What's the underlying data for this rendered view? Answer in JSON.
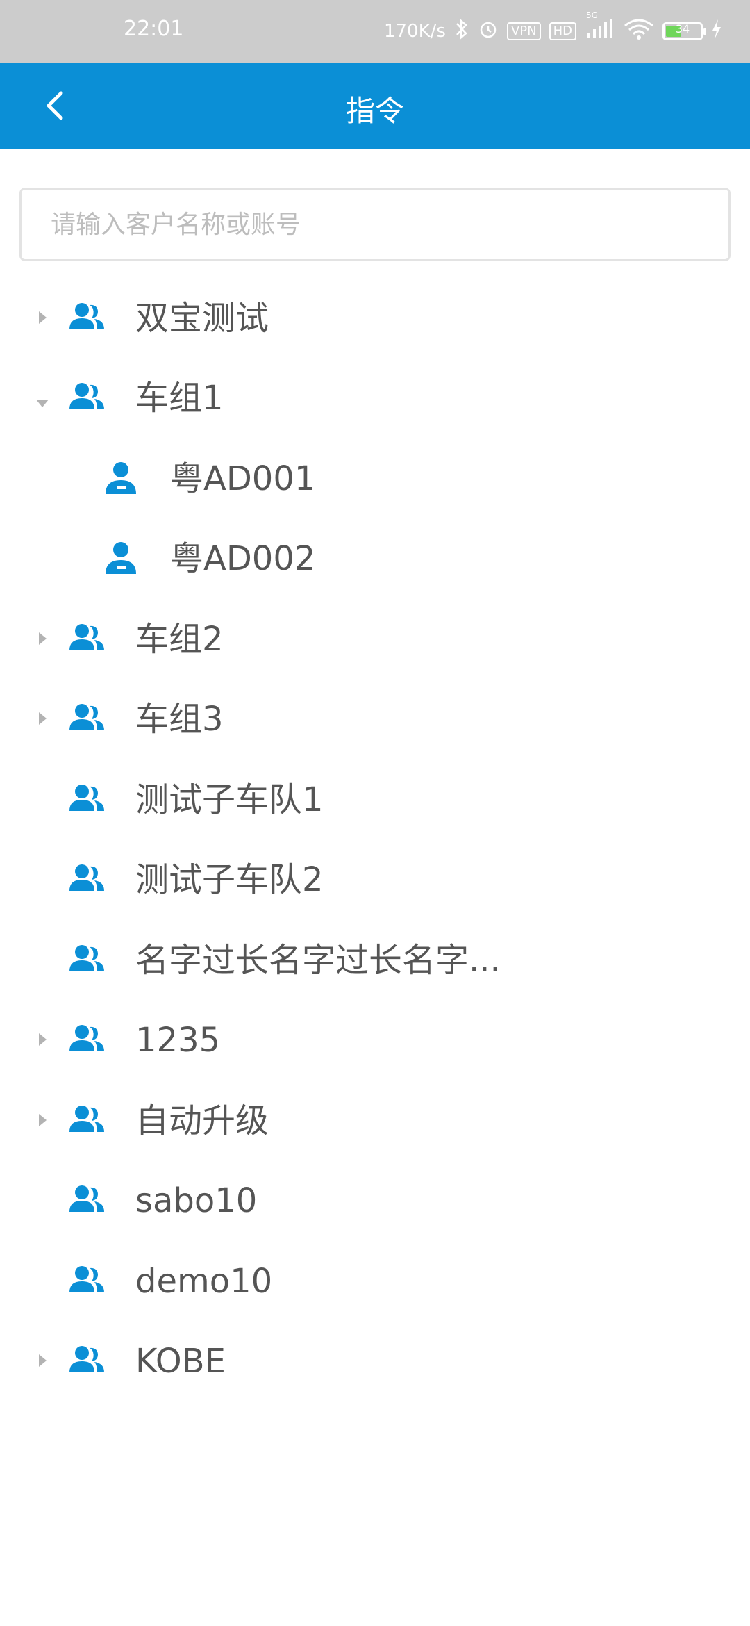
{
  "status_bar": {
    "time": "22:01",
    "network_speed": "170K/s",
    "vpn": "VPN",
    "hd": "HD",
    "signal_label": "5G",
    "battery_level": "34"
  },
  "header": {
    "title": "指令",
    "back_icon": "chevron-left-icon"
  },
  "search": {
    "placeholder": "请输入客户名称或账号",
    "value": ""
  },
  "colors": {
    "accent": "#0b8fd6",
    "icon": "#0b8fd6",
    "text": "#555555",
    "arrow": "#b3b3b3"
  },
  "tree": {
    "items": [
      {
        "label": "双宝测试",
        "toggle": "collapsed",
        "icon": "group-icon"
      },
      {
        "label": "车组1",
        "toggle": "expanded",
        "icon": "group-icon"
      },
      {
        "label": "粤AD001",
        "toggle": "none",
        "icon": "driver-icon"
      },
      {
        "label": "粤AD002",
        "toggle": "none",
        "icon": "driver-icon"
      },
      {
        "label": "车组2",
        "toggle": "collapsed",
        "icon": "group-icon"
      },
      {
        "label": "车组3",
        "toggle": "collapsed",
        "icon": "group-icon"
      },
      {
        "label": "测试子车队1",
        "toggle": "none",
        "icon": "group-icon"
      },
      {
        "label": "测试子车队2",
        "toggle": "none",
        "icon": "group-icon"
      },
      {
        "label": "名字过长名字过长名字...",
        "toggle": "none",
        "icon": "group-icon"
      },
      {
        "label": "1235",
        "toggle": "collapsed",
        "icon": "group-icon"
      },
      {
        "label": "自动升级",
        "toggle": "collapsed",
        "icon": "group-icon"
      },
      {
        "label": "sabo10",
        "toggle": "none",
        "icon": "group-icon"
      },
      {
        "label": "demo10",
        "toggle": "none",
        "icon": "group-icon"
      },
      {
        "label": "KOBE",
        "toggle": "collapsed",
        "icon": "group-icon"
      }
    ]
  }
}
